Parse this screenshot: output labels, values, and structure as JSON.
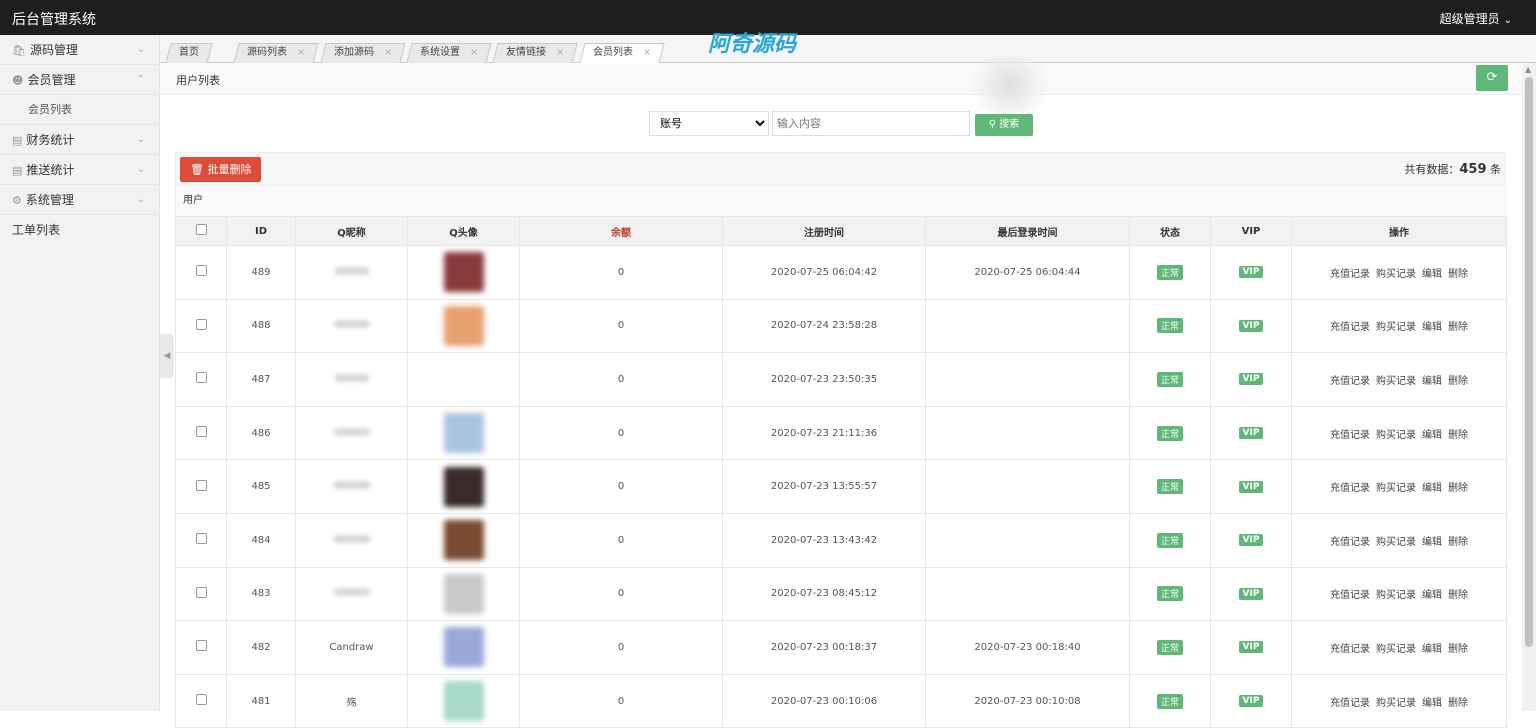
{
  "app": {
    "title": "后台管理系统",
    "user_menu": "超级管理员"
  },
  "sidebar": {
    "items": [
      {
        "label": "源码管理",
        "icon": "bag-icon",
        "expanded": false
      },
      {
        "label": "会员管理",
        "icon": "user-icon",
        "expanded": true,
        "children": [
          "会员列表"
        ]
      },
      {
        "label": "财务统计",
        "icon": "chart-icon",
        "expanded": false
      },
      {
        "label": "推送统计",
        "icon": "chart-icon",
        "expanded": false
      },
      {
        "label": "系统管理",
        "icon": "gear-icon",
        "expanded": false
      }
    ],
    "plain_item": "工单列表"
  },
  "tabs": [
    "首页",
    "源码列表",
    "添加源码",
    "系统设置",
    "友情链接",
    "会员列表"
  ],
  "active_tab": "会员列表",
  "watermark": "阿奇源码",
  "breadcrumb": "用户列表",
  "search": {
    "field_selected": "账号",
    "placeholder": "输入内容",
    "button": "搜索"
  },
  "toolbar": {
    "bulk_delete": "批量删除",
    "total_prefix": "共有数据：",
    "total_count": "459",
    "total_suffix": "条"
  },
  "table_title": "用户",
  "columns": [
    "ID",
    "Q昵称",
    "Q头像",
    "余额",
    "注册时间",
    "最后登录时间",
    "状态",
    "VIP",
    "操作"
  ],
  "row_actions": [
    "充值记录",
    "购买记录",
    "编辑",
    "删除"
  ],
  "rows": [
    {
      "id": "489",
      "nick": "",
      "balance": "0",
      "reg": "2020-07-25 06:04:42",
      "last": "2020-07-25 06:04:44",
      "status": "正常",
      "vip": "VIP",
      "avatar_color": "#8a3a3a"
    },
    {
      "id": "488",
      "nick": "",
      "balance": "0",
      "reg": "2020-07-24 23:58:28",
      "last": "",
      "status": "正常",
      "vip": "VIP",
      "avatar_color": "#e8a070"
    },
    {
      "id": "487",
      "nick": "",
      "balance": "0",
      "reg": "2020-07-23 23:50:35",
      "last": "",
      "status": "正常",
      "vip": "VIP",
      "avatar_color": ""
    },
    {
      "id": "486",
      "nick": "",
      "balance": "0",
      "reg": "2020-07-23 21:11:36",
      "last": "",
      "status": "正常",
      "vip": "VIP",
      "avatar_color": "#aac4e0"
    },
    {
      "id": "485",
      "nick": "",
      "balance": "0",
      "reg": "2020-07-23 13:55:57",
      "last": "",
      "status": "正常",
      "vip": "VIP",
      "avatar_color": "#3a2a2a"
    },
    {
      "id": "484",
      "nick": "",
      "balance": "0",
      "reg": "2020-07-23 13:43:42",
      "last": "",
      "status": "正常",
      "vip": "VIP",
      "avatar_color": "#7a4a30"
    },
    {
      "id": "483",
      "nick": "",
      "balance": "0",
      "reg": "2020-07-23 08:45:12",
      "last": "",
      "status": "正常",
      "vip": "VIP",
      "avatar_color": "#c8c8c8"
    },
    {
      "id": "482",
      "nick": "Candraw",
      "balance": "0",
      "reg": "2020-07-23 00:18:37",
      "last": "2020-07-23 00:18:40",
      "status": "正常",
      "vip": "VIP",
      "avatar_color": "#9aa8d8"
    },
    {
      "id": "481",
      "nick": "殇",
      "balance": "0",
      "reg": "2020-07-23 00:10:06",
      "last": "2020-07-23 00:10:08",
      "status": "正常",
      "vip": "VIP",
      "avatar_color": "#a8d8c8"
    }
  ],
  "colors": {
    "accent": "#5fb878",
    "danger": "#dd4b39",
    "topbar": "#1e1e1e"
  }
}
